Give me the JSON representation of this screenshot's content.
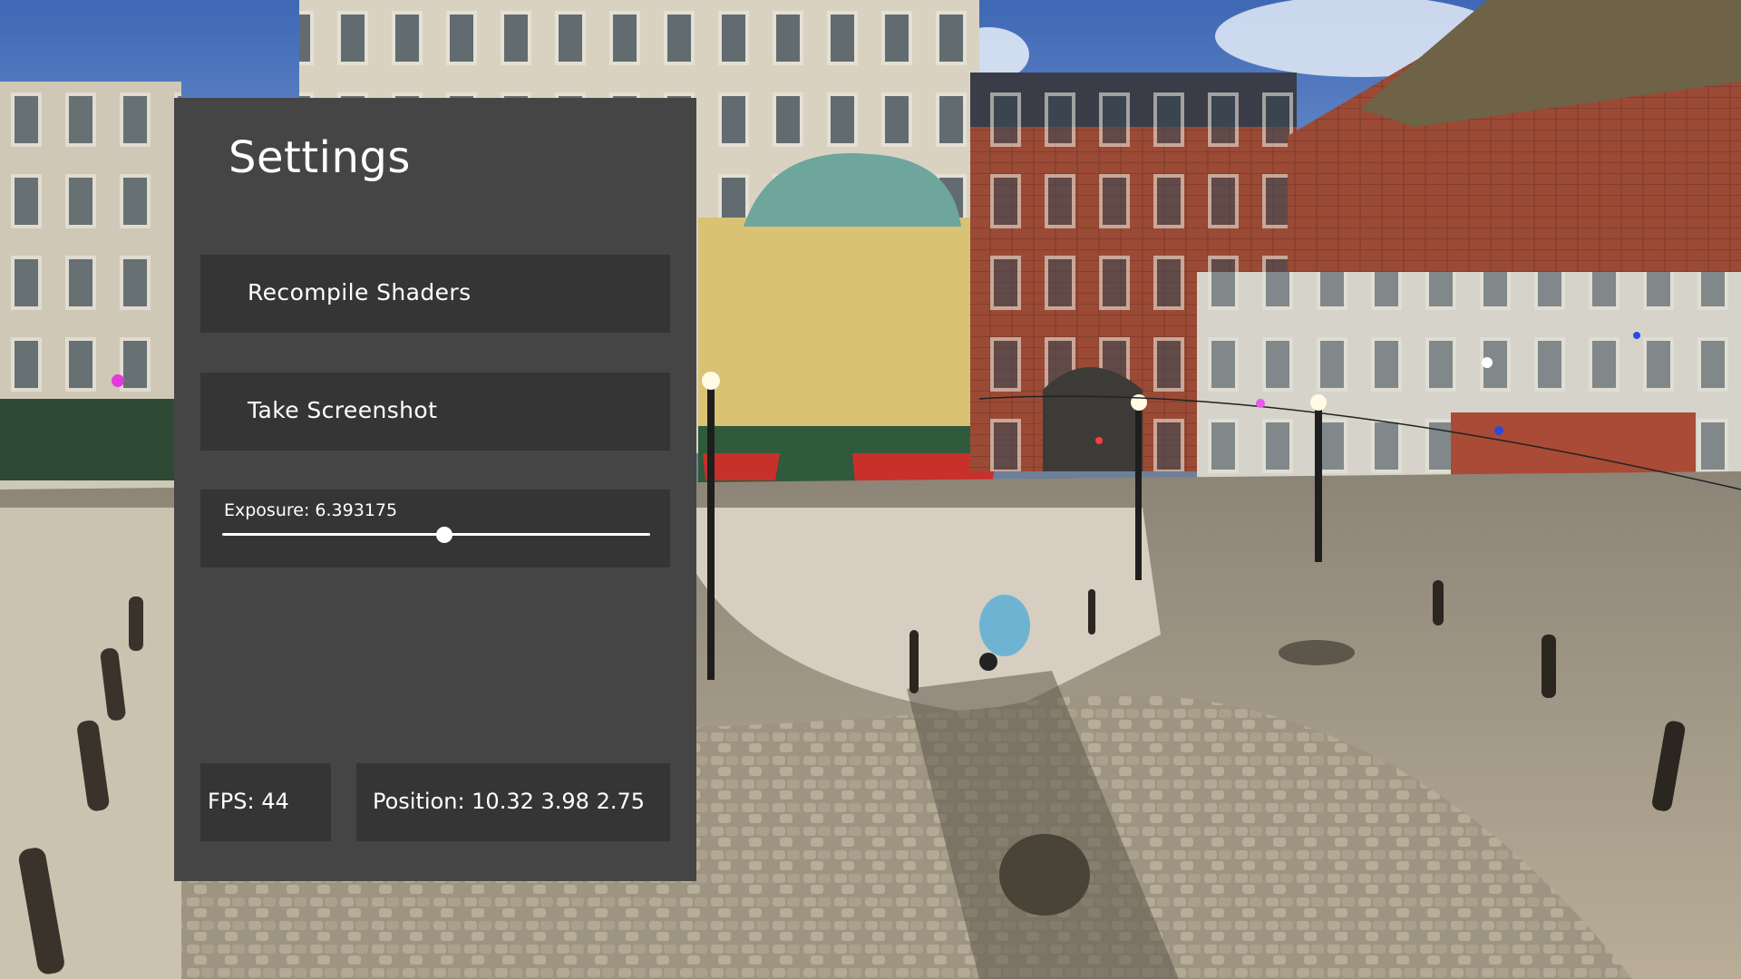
{
  "settings_panel": {
    "title": "Settings",
    "recompile_label": "Recompile Shaders",
    "screenshot_label": "Take Screenshot",
    "exposure_label": "Exposure: 6.393175",
    "exposure_slider_fraction": 0.52,
    "fps_text": "FPS: 44",
    "position_text": "Position: 10.32 3.98 2.75"
  },
  "colors": {
    "panel_bg": "#454545",
    "control_bg": "#353535",
    "text": "#ffffff"
  }
}
